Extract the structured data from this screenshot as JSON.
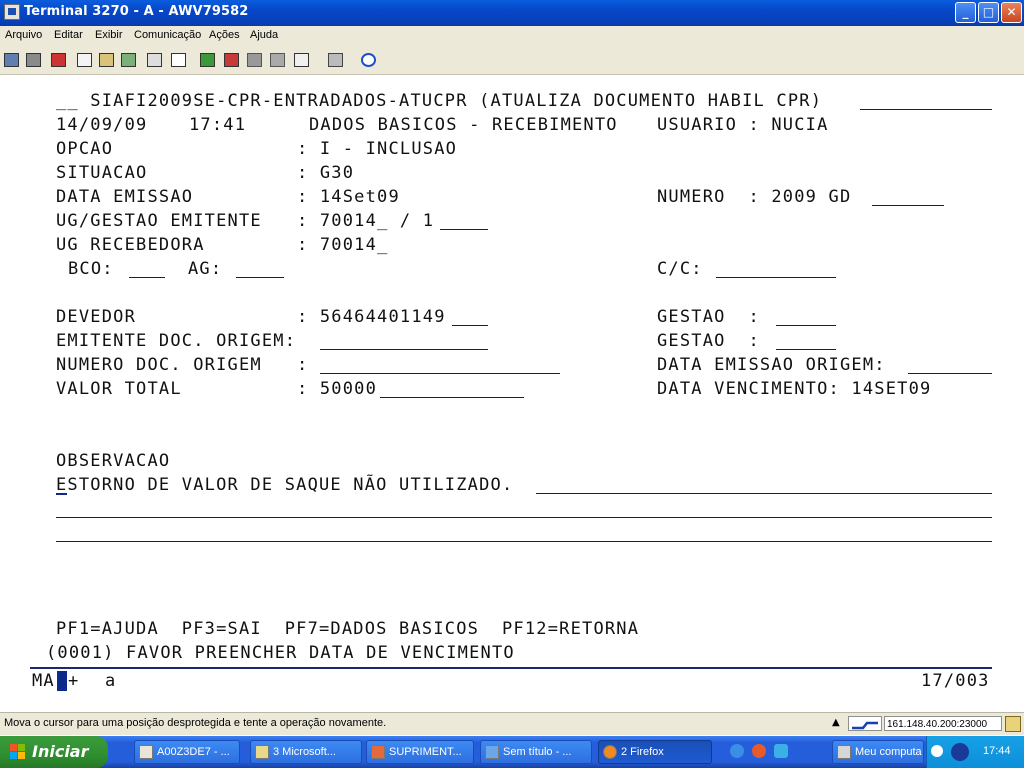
{
  "window": {
    "title": "Terminal 3270 - A - AWV79582",
    "min": "_",
    "max": "□",
    "close": "✕"
  },
  "menu": [
    "Arquivo",
    "Editar",
    "Exibir",
    "Comunicação",
    "Ações",
    "Ajuda"
  ],
  "toolbar_icons": [
    "print-screen-icon",
    "print-icon",
    "transfer-icon",
    "copy-icon",
    "paste-icon",
    "copy-append-icon",
    "macro-icon",
    "keypad-icon",
    "send-file-icon",
    "receive-file-icon",
    "disconnect-icon",
    "settings-icon",
    "keyboard-icon",
    "cassette-icon",
    "help-icon"
  ],
  "screen": {
    "header": "__ SIAFI2009SE-CPR-ENTRADADOS-ATUCPR (ATUALIZA DOCUMENTO HABIL CPR)",
    "date": "14/09/09",
    "time": "17:41",
    "subtitle": "DADOS BASICOS - RECEBIMENTO",
    "user": "USUARIO : NUCIA",
    "opcao_label": "OPCAO",
    "opcao_value": ": I - INCLUSAO",
    "situacao_label": "SITUACAO",
    "situacao_value": ": G30",
    "emissao_label": "DATA EMISSAO",
    "emissao_value": ": 14Set09",
    "numero": "NUMERO  : 2009 GD",
    "ug_emit_label": "UG/GESTAO EMITENTE",
    "ug_emit_value": ": 70014_ / 1",
    "ug_rec_label": "UG RECEBEDORA",
    "ug_rec_value": ": 70014_",
    "bco": "BCO:",
    "ag": "AG:",
    "cc": "C/C:",
    "devedor_label": "DEVEDOR",
    "devedor_value": ": 56464401149",
    "gestao1": "GESTAO  :",
    "emitente_doc": "EMITENTE DOC. ORIGEM:",
    "gestao2": "GESTAO  :",
    "numero_doc_label": "NUMERO DOC. ORIGEM",
    "numero_doc_colon": ":",
    "data_emissao_origem": "DATA EMISSAO ORIGEM:",
    "valor_label": "VALOR TOTAL",
    "valor_value": ": 50000",
    "vencimento": "DATA VENCIMENTO: 14SET09",
    "observacao_label": "OBSERVACAO",
    "observacao_text": "ESTORNO DE VALOR DE SAQUE NÃO UTILIZADO.",
    "pf_keys": "PF1=AJUDA  PF3=SAI  PF7=DADOS BASICOS  PF12=RETORNA",
    "message": "(0001) FAVOR PREENCHER DATA DE VENCIMENTO",
    "oia_left": "MA",
    "oia_plus": "+",
    "oia_a": "a",
    "oia_pos": "17/003"
  },
  "statusbar": {
    "message": "Mova o cursor para uma posição desprotegida e tente a operação novamente.",
    "ip": "161.148.40.200:23000"
  },
  "taskbar": {
    "start": "Iniciar",
    "tasks": [
      "A00Z3DE7 - ...",
      "3 Microsoft...",
      "SUPRIMENT...",
      "Sem título - ...",
      "2 Firefox",
      "Meu computa"
    ],
    "clock": "17:44"
  }
}
